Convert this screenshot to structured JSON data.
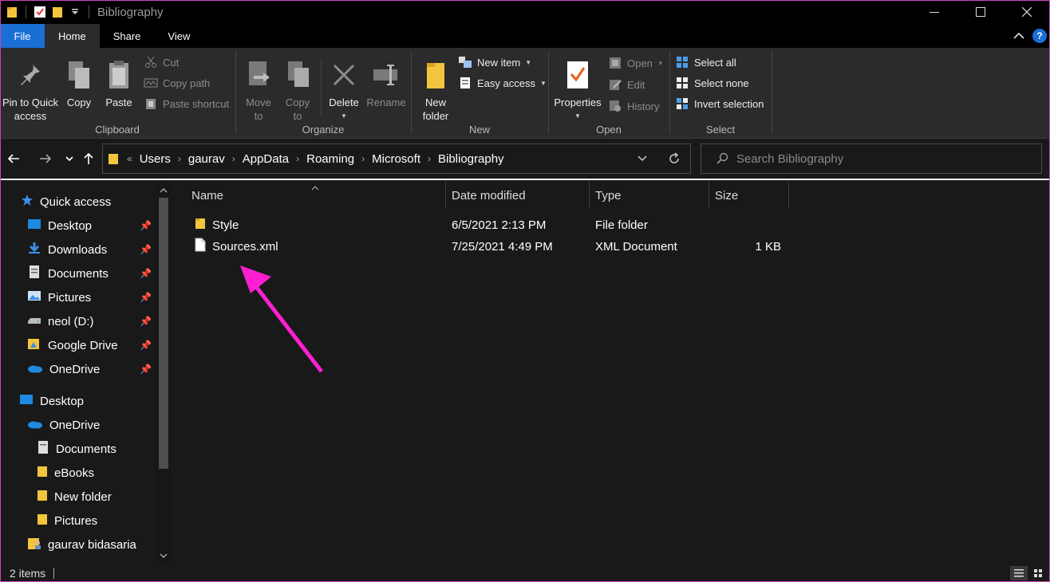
{
  "window": {
    "title": "Bibliography"
  },
  "tabs": [
    {
      "label": "File"
    },
    {
      "label": "Home"
    },
    {
      "label": "Share"
    },
    {
      "label": "View"
    }
  ],
  "ribbon": {
    "clipboard": {
      "label": "Clipboard",
      "pin": "Pin to Quick access",
      "pin_line1": "Pin to Quick",
      "pin_line2": "access",
      "copy": "Copy",
      "paste": "Paste",
      "cut": "Cut",
      "copy_path": "Copy path",
      "paste_shortcut": "Paste shortcut"
    },
    "organize": {
      "label": "Organize",
      "move_to_line1": "Move",
      "move_to_line2": "to",
      "copy_to_line1": "Copy",
      "copy_to_line2": "to",
      "delete": "Delete",
      "rename": "Rename"
    },
    "new": {
      "label": "New",
      "new_folder_line1": "New",
      "new_folder_line2": "folder",
      "new_item": "New item",
      "easy_access": "Easy access"
    },
    "open": {
      "label": "Open",
      "properties": "Properties",
      "open": "Open",
      "edit": "Edit",
      "history": "History"
    },
    "select": {
      "label": "Select",
      "select_all": "Select all",
      "select_none": "Select none",
      "invert_selection": "Invert selection"
    }
  },
  "address": {
    "crumbs": [
      "Users",
      "gaurav",
      "AppData",
      "Roaming",
      "Microsoft",
      "Bibliography"
    ],
    "overflow": "«",
    "separator": "›"
  },
  "search": {
    "placeholder": "Search Bibliography"
  },
  "navpane": {
    "quick_access": "Quick access",
    "quick_items": [
      {
        "label": "Desktop",
        "icon": "desktop-icon"
      },
      {
        "label": "Downloads",
        "icon": "download-icon"
      },
      {
        "label": "Documents",
        "icon": "documents-icon"
      },
      {
        "label": "Pictures",
        "icon": "pictures-icon"
      },
      {
        "label": "neol (D:)",
        "icon": "drive-icon"
      },
      {
        "label": "Google Drive",
        "icon": "google-drive-icon"
      },
      {
        "label": "OneDrive",
        "icon": "onedrive-icon"
      }
    ],
    "desktop": "Desktop",
    "onedrive": "OneDrive",
    "onedrive_items": [
      {
        "label": "Documents"
      },
      {
        "label": "eBooks"
      },
      {
        "label": "New folder"
      },
      {
        "label": "Pictures"
      }
    ],
    "user": "gaurav bidasaria"
  },
  "columns": {
    "name": "Name",
    "date": "Date modified",
    "type": "Type",
    "size": "Size"
  },
  "files": [
    {
      "name": "Style",
      "date": "6/5/2021 2:13 PM",
      "type": "File folder",
      "size": ""
    },
    {
      "name": "Sources.xml",
      "date": "7/25/2021 4:49 PM",
      "type": "XML Document",
      "size": "1 KB"
    }
  ],
  "status": {
    "items": "2 items"
  },
  "colors": {
    "accent": "#1a6fd4",
    "annotation_arrow": "#ff1fd2",
    "folder": "#f2c53d"
  }
}
